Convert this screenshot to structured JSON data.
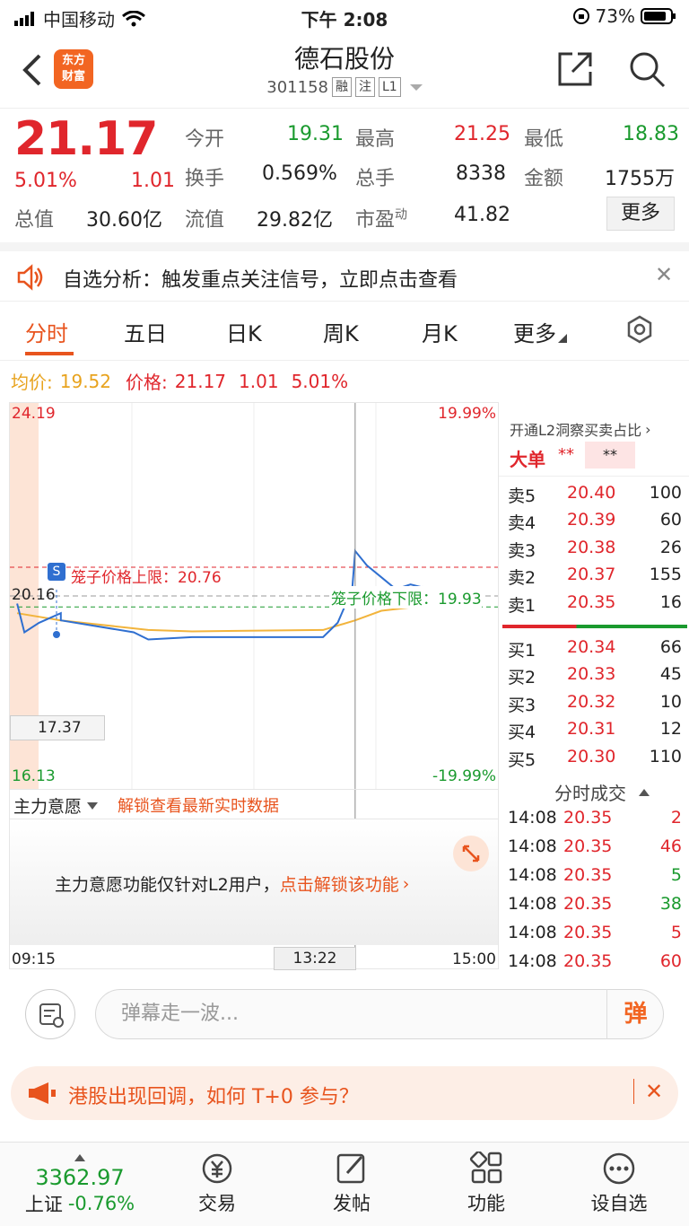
{
  "status": {
    "carrier": "中国移动",
    "time": "下午 2:08",
    "battery": "73%"
  },
  "header": {
    "logo_line1": "东方",
    "logo_line2": "财富",
    "title": "德石股份",
    "code": "301158",
    "tags": [
      "融",
      "注",
      "L1"
    ]
  },
  "quote": {
    "price": "21.17",
    "change_pct": "5.01%",
    "change": "1.01",
    "open_label": "今开",
    "open": "19.31",
    "high_label": "最高",
    "high": "21.25",
    "low_label": "最低",
    "low": "18.83",
    "turnover_label": "换手",
    "turnover": "0.569%",
    "volume_label": "总手",
    "volume": "8338",
    "amount_label": "金额",
    "amount": "1755万",
    "mcap_label": "总值",
    "mcap": "30.60亿",
    "float_label": "流值",
    "float": "29.82亿",
    "pe_label": "市盈",
    "pe_sup": "动",
    "pe": "41.82",
    "more": "更多"
  },
  "notice": {
    "text": "自选分析：触发重点关注信号，立即点击查看"
  },
  "tabs": [
    "分时",
    "五日",
    "日K",
    "周K",
    "月K",
    "更多"
  ],
  "legend": {
    "avg_label": "均价:",
    "avg": "19.52",
    "price_label": "价格:",
    "price": "21.17",
    "change": "1.01",
    "pct": "5.01%"
  },
  "chart": {
    "y_top": "24.19",
    "y_mid": "20.16",
    "y_bottom": "16.13",
    "pct_top": "19.99%",
    "pct_bottom": "-19.99%",
    "cross_price": "17.37",
    "cage_upper": "笼子价格上限：20.76",
    "cage_lower": "笼子价格下限：19.93",
    "s_badge": "S",
    "x_start": "09:15",
    "x_cursor": "13:22",
    "x_end": "15:00",
    "sub_selector": "主力意愿",
    "sub_unlock": "解锁查看最新实时数据",
    "sub_msg": "主力意愿功能仅针对L2用户，",
    "sub_link": "点击解锁该功能"
  },
  "chart_data": {
    "type": "line",
    "title": "",
    "x_range": [
      "09:15",
      "15:00"
    ],
    "ylim": [
      16.13,
      24.19
    ],
    "reference_price": 20.16,
    "series": [
      {
        "name": "",
        "points": [
          [
            9.3,
            20.0
          ],
          [
            9.35,
            19.4
          ],
          [
            9.45,
            19.6
          ],
          [
            9.6,
            19.8
          ],
          [
            10.0,
            19.65
          ],
          [
            10.5,
            19.4
          ],
          [
            11.0,
            19.25
          ],
          [
            11.3,
            19.3
          ],
          [
            13.0,
            19.3
          ],
          [
            13.1,
            19.6
          ],
          [
            13.2,
            20.3
          ],
          [
            13.22,
            21.1
          ],
          [
            13.3,
            20.8
          ],
          [
            13.4,
            20.55
          ],
          [
            13.5,
            20.3
          ],
          [
            13.6,
            20.4
          ],
          [
            13.8,
            20.25
          ],
          [
            14.08,
            20.35
          ]
        ]
      },
      {
        "name": "均价",
        "points": [
          [
            9.3,
            19.8
          ],
          [
            10.0,
            19.65
          ],
          [
            11.0,
            19.45
          ],
          [
            11.3,
            19.42
          ],
          [
            13.0,
            19.45
          ],
          [
            13.22,
            19.65
          ],
          [
            13.4,
            19.85
          ],
          [
            14.08,
            19.95
          ]
        ]
      }
    ]
  },
  "book": {
    "header": "开通L2洞察买卖占比",
    "big_label": "大单",
    "big_v1": "**",
    "big_v2": "**",
    "sell": [
      {
        "label": "卖5",
        "price": "20.40",
        "vol": "100"
      },
      {
        "label": "卖4",
        "price": "20.39",
        "vol": "60"
      },
      {
        "label": "卖3",
        "price": "20.38",
        "vol": "26"
      },
      {
        "label": "卖2",
        "price": "20.37",
        "vol": "155"
      },
      {
        "label": "卖1",
        "price": "20.35",
        "vol": "16"
      }
    ],
    "buy": [
      {
        "label": "买1",
        "price": "20.34",
        "vol": "66"
      },
      {
        "label": "买2",
        "price": "20.33",
        "vol": "45"
      },
      {
        "label": "买3",
        "price": "20.32",
        "vol": "10"
      },
      {
        "label": "买4",
        "price": "20.31",
        "vol": "12"
      },
      {
        "label": "买5",
        "price": "20.30",
        "vol": "110"
      }
    ],
    "trades_title": "分时成交",
    "trades": [
      {
        "time": "14:08",
        "price": "20.35",
        "vol": "2",
        "side": "sell"
      },
      {
        "time": "14:08",
        "price": "20.35",
        "vol": "46",
        "side": "sell"
      },
      {
        "time": "14:08",
        "price": "20.35",
        "vol": "5",
        "side": "buy"
      },
      {
        "time": "14:08",
        "price": "20.35",
        "vol": "38",
        "side": "buy"
      },
      {
        "time": "14:08",
        "price": "20.35",
        "vol": "5",
        "side": "sell"
      },
      {
        "time": "14:08",
        "price": "20.35",
        "vol": "60",
        "side": "sell"
      }
    ]
  },
  "danmaku": {
    "placeholder": "弹幕走一波...",
    "button": "弹"
  },
  "promo": {
    "text": "港股出现回调，如何 T+0 参与？"
  },
  "nav": {
    "index_value": "3362.97",
    "index_name": "上证",
    "index_change": "-0.76%",
    "items": [
      "交易",
      "发帖",
      "功能",
      "设自选"
    ]
  }
}
